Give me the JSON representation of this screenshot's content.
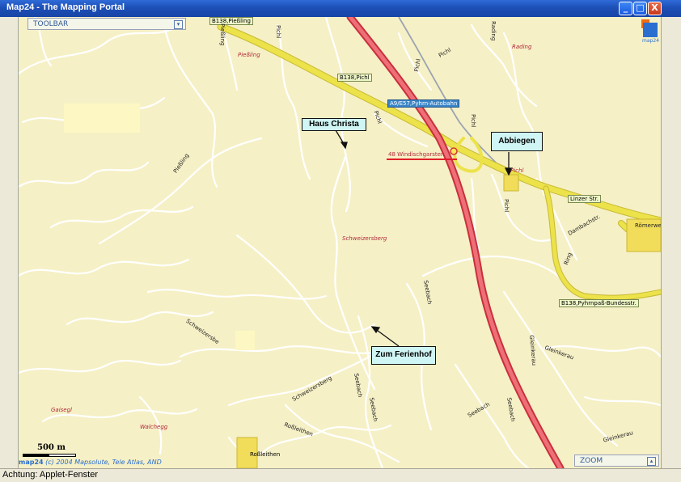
{
  "window": {
    "title": "Map24 - The Mapping Portal",
    "minimize": "_",
    "maximize": "□",
    "close": "X"
  },
  "toolbar": {
    "label": "TOOLBAR"
  },
  "zoom": {
    "label": "ZOOM"
  },
  "status": {
    "text": "Achtung: Applet-Fenster"
  },
  "logo": {
    "text": "map24"
  },
  "copyright": {
    "brand": "map24",
    "text": "(c) 2004 Mapsolute, Tele Atlas, AND"
  },
  "scale": {
    "label": "500 m"
  },
  "callouts": {
    "haus_christa": "Haus Christa",
    "abbiegen": "Abbiegen",
    "zum_ferienhof": "Zum Ferienhof"
  },
  "road_shields": {
    "b138_piessling": "B138,Pießling",
    "b138_pichl": "B138,Pichl",
    "a9": "A9/E57,Pyhrn-Autobahn",
    "linzer_str": "Linzer Str.",
    "b138_pyhrnpass": "B138,Pyhrnpaß-Bundesstr."
  },
  "places": {
    "piessling": "Pießling",
    "windischgarsten": "48 Windischgarsten",
    "pichl": "Pichl",
    "schweizersberg": "Schweizersberg",
    "gaisegg": "Gaisegl",
    "walchegg": "Walchegg",
    "rossleithen": "Roßleithen",
    "rading": "Rading"
  },
  "streets": {
    "piessling_v": "Pießling",
    "piessling_diag": "Pießling",
    "pichl_1": "Pichl",
    "pichl_2": "Pichl",
    "pichl_3": "Pichl",
    "pichl_4": "Pichl",
    "pichl_5": "Pichl",
    "pichl_6": "Pichl",
    "schweizersbe": "Schweizersbe",
    "schweizersberg_low": "Schweizersberg",
    "seebach_1": "Seebach",
    "seebach_2": "Seebach",
    "seebach_3": "Seebach",
    "seebach_4": "Seebach",
    "seebach_5": "Seebach",
    "rossleithen_st": "Roßleithen",
    "gleinkerau_1": "Gleinkerau",
    "gleinkerau_2": "Gleinkerau",
    "gleinkerau_3": "Gleinkerau",
    "dambachstr": "Dambachstr.",
    "roemerweg": "Römerweg",
    "rading_st": "Rading",
    "ringstr": "Ring"
  },
  "colors": {
    "map_bg": "#f6f0c6",
    "highway": "#e8545e",
    "main_road": "#ece24a",
    "minor_road": "#ffffff",
    "callout": "#cff5f4",
    "place_label": "#b0293a"
  }
}
